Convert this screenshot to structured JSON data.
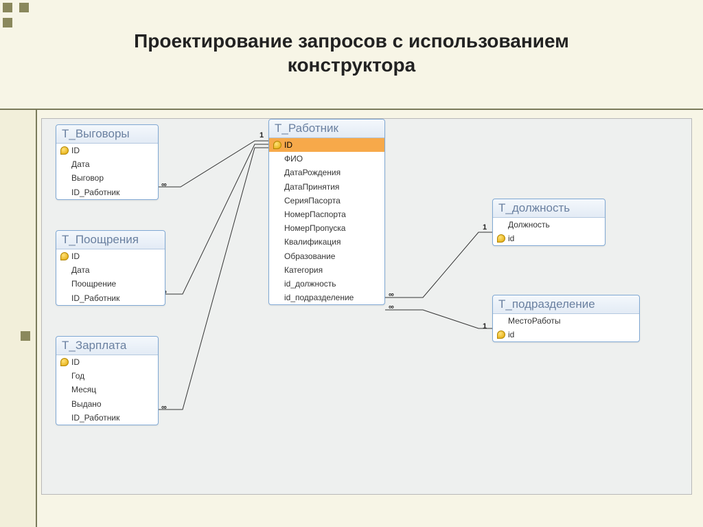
{
  "slide": {
    "title_line1": "Проектирование запросов с использованием",
    "title_line2": "конструктора"
  },
  "tables": {
    "vygovory": {
      "title": "Т_Выговоры",
      "fields": [
        "ID",
        "Дата",
        "Выговор",
        "ID_Работник"
      ],
      "keys": [
        0
      ]
    },
    "pooshreniya": {
      "title": "Т_Поощрения",
      "fields": [
        "ID",
        "Дата",
        "Поощрение",
        "ID_Работник"
      ],
      "keys": [
        0
      ]
    },
    "zarplata": {
      "title": "Т_Зарплата",
      "fields": [
        "ID",
        "Год",
        "Месяц",
        "Выдано",
        "ID_Работник"
      ],
      "keys": [
        0
      ]
    },
    "rabotnik": {
      "title": "Т_Работник",
      "fields": [
        "ID",
        "ФИО",
        "ДатаРождения",
        "ДатаПринятия",
        "СерияПасорта",
        "НомерПаспорта",
        "НомерПропуска",
        "Квалификация",
        "Образование",
        "Категория",
        "id_должность",
        "id_подразделение"
      ],
      "keys": [
        0
      ],
      "selected": [
        0
      ]
    },
    "dolzhnost": {
      "title": "Т_должность",
      "fields": [
        "Должность",
        "id"
      ],
      "keys": [
        1
      ]
    },
    "podrazdelenie": {
      "title": "Т_подразделение",
      "fields": [
        "МестоРаботы",
        "id"
      ],
      "keys": [
        1
      ]
    }
  },
  "relations": {
    "one": "1",
    "many": "∞"
  }
}
